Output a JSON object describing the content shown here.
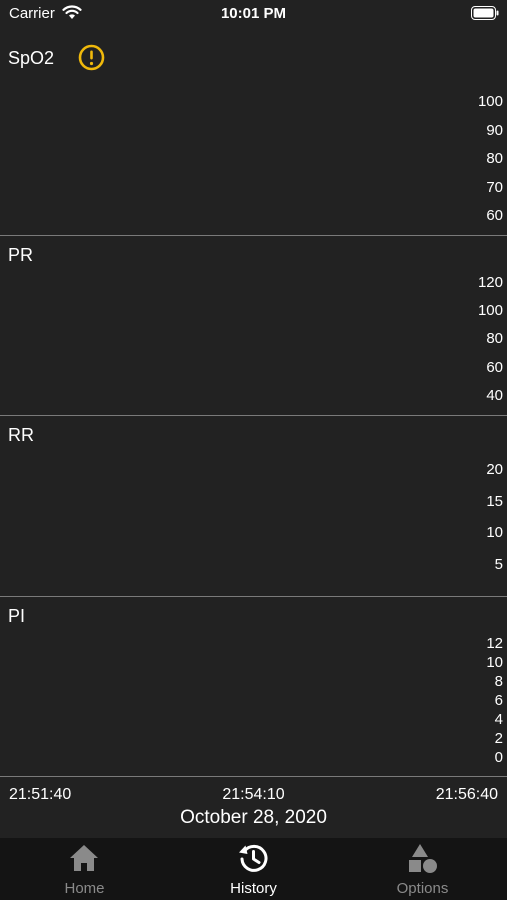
{
  "status_bar": {
    "carrier": "Carrier",
    "time": "10:01 PM"
  },
  "panels": {
    "spo2": {
      "title": "SpO2",
      "ticks": [
        "100",
        "90",
        "80",
        "70",
        "60"
      ],
      "alert_icon": "warning-circle-icon",
      "alert_color": "#F0B90B"
    },
    "pr": {
      "title": "PR",
      "ticks": [
        "120",
        "100",
        "80",
        "60",
        "40"
      ]
    },
    "rr": {
      "title": "RR",
      "ticks": [
        "20",
        "15",
        "10",
        "5"
      ]
    },
    "pi": {
      "title": "PI",
      "ticks": [
        "12",
        "10",
        "8",
        "6",
        "4",
        "2",
        "0"
      ]
    }
  },
  "time_axis": {
    "start": "21:51:40",
    "middle": "21:54:10",
    "end": "21:56:40",
    "date": "October 28, 2020"
  },
  "tabbar": {
    "tabs": [
      {
        "label": "Home",
        "icon": "home-icon",
        "selected": false
      },
      {
        "label": "History",
        "icon": "history-icon",
        "selected": true
      },
      {
        "label": "Options",
        "icon": "shapes-icon",
        "selected": false
      }
    ]
  },
  "colors": {
    "background": "#222222",
    "tabbar_background": "#141414",
    "inactive": "#8A8A8A",
    "active": "#FFFFFF"
  }
}
